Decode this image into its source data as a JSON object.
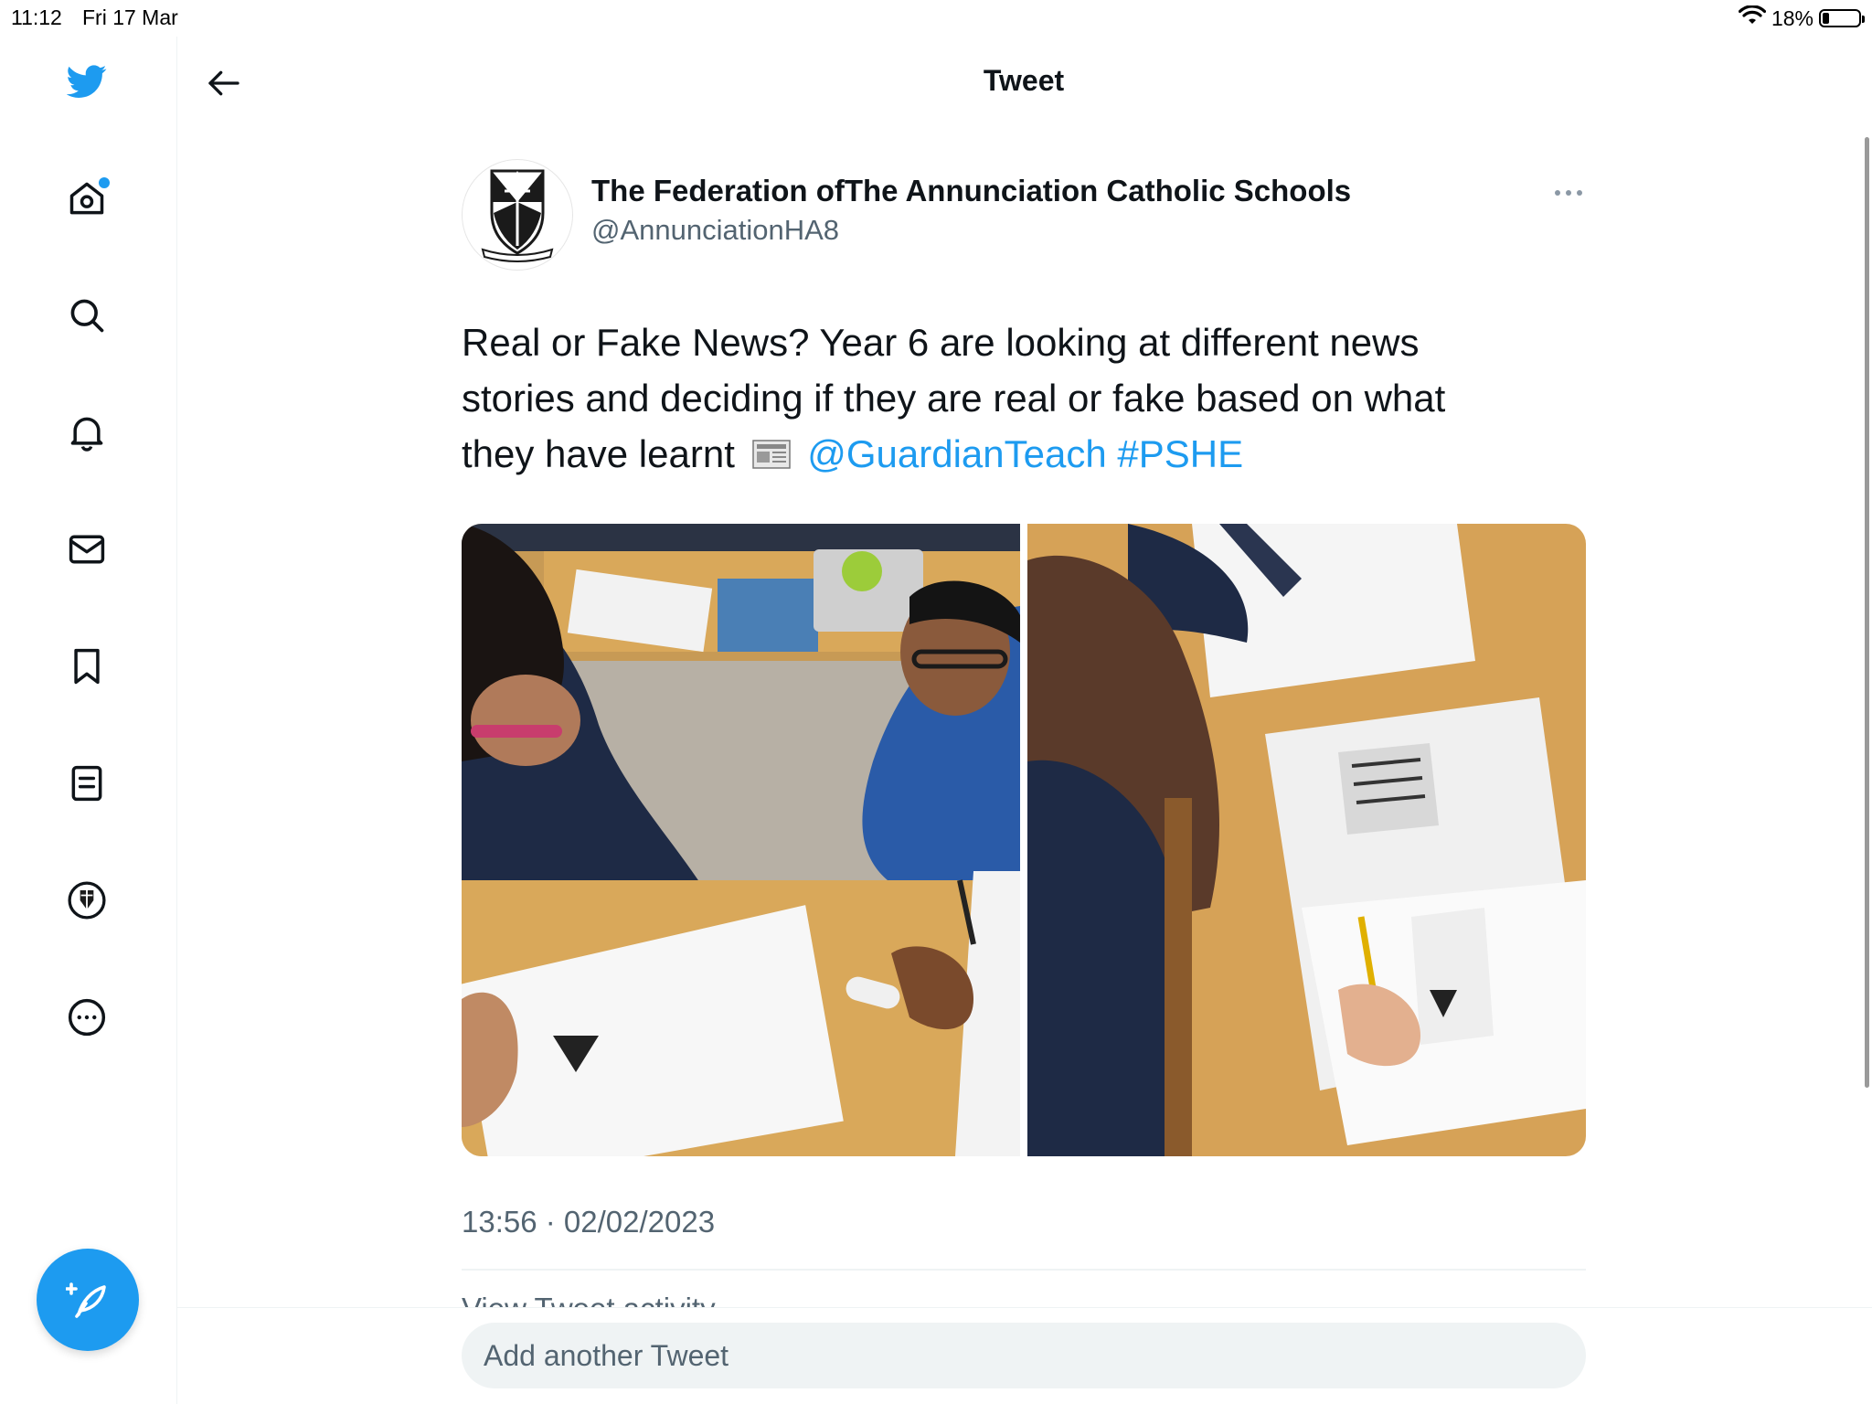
{
  "status_bar": {
    "time": "11:12",
    "date": "Fri 17 Mar",
    "battery_percent": "18%",
    "battery_level": 0.18
  },
  "header": {
    "title": "Tweet"
  },
  "tweet": {
    "author_name": "The Federation ofThe Annunciation Catholic Schools",
    "author_handle": "@AnnunciationHA8",
    "text_line1": "Real or Fake News? Year 6 are looking at different news",
    "text_line2": "stories and deciding if they are real or fake based on what",
    "text_line3_start": "they have learnt",
    "mention": "@GuardianTeach",
    "hashtag": "#PSHE",
    "timestamp": "13:56 · 02/02/2023",
    "activity_label": "View Tweet activity"
  },
  "reply": {
    "placeholder": "Add another Tweet"
  },
  "colors": {
    "accent": "#1d9bf0",
    "text": "#0f1419",
    "secondary_text": "#536471"
  },
  "icons": {
    "logo": "twitter-bird-icon",
    "home": "home-icon",
    "explore": "search-icon",
    "notifications": "bell-icon",
    "messages": "envelope-icon",
    "bookmarks": "bookmark-icon",
    "lists": "list-icon",
    "profile": "profile-avatar-icon",
    "more": "more-circle-icon",
    "compose": "compose-feather-icon"
  }
}
